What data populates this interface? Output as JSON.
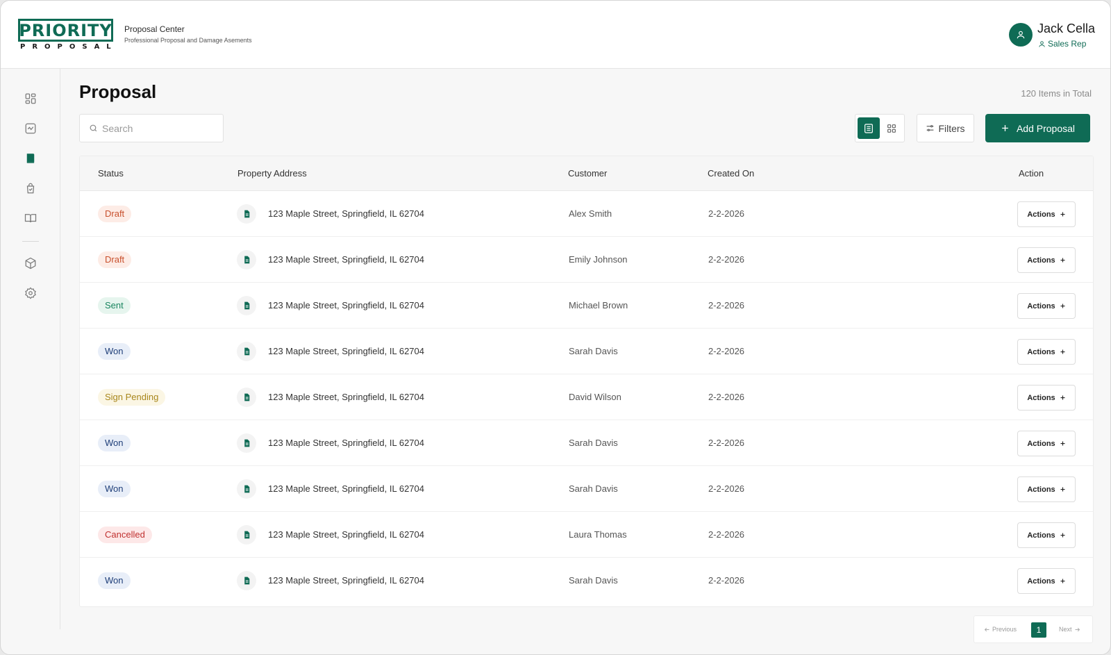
{
  "brand": {
    "logo_top": "PRIORITY",
    "logo_bottom": "PROPOSAL",
    "app_title": "Proposal Center",
    "app_subtitle": "Professional Proposal and Damage Asements",
    "accent": "#0f6b55"
  },
  "user": {
    "name": "Jack Cella",
    "role": "Sales Rep"
  },
  "sidebar": {
    "items": [
      {
        "icon": "dashboard-icon",
        "active": false
      },
      {
        "icon": "activity-icon",
        "active": false
      },
      {
        "icon": "book-icon",
        "active": true
      },
      {
        "icon": "bag-check-icon",
        "active": false
      },
      {
        "icon": "open-book-icon",
        "active": false
      },
      {
        "icon": "box-icon",
        "active": false
      },
      {
        "icon": "settings-icon",
        "active": false
      }
    ]
  },
  "page": {
    "title": "Proposal",
    "total": "120 Items in Total",
    "search_placeholder": "Search",
    "filters_label": "Filters",
    "add_label": "Add Proposal"
  },
  "table": {
    "columns": [
      "Status",
      "Property Address",
      "Customer",
      "Created On",
      "Action"
    ],
    "rows": [
      {
        "status": "Draft",
        "address": "123 Maple Street, Springfield, IL 62704",
        "customer": "Alex Smith",
        "created": "2-2-2026",
        "action": "Actions"
      },
      {
        "status": "Draft",
        "address": "123 Maple Street, Springfield, IL 62704",
        "customer": "Emily Johnson",
        "created": "2-2-2026",
        "action": "Actions"
      },
      {
        "status": "Sent",
        "address": "123 Maple Street, Springfield, IL 62704",
        "customer": "Michael Brown",
        "created": "2-2-2026",
        "action": "Actions"
      },
      {
        "status": "Won",
        "address": "123 Maple Street, Springfield, IL 62704",
        "customer": "Sarah Davis",
        "created": "2-2-2026",
        "action": "Actions"
      },
      {
        "status": "Sign Pending",
        "address": "123 Maple Street, Springfield, IL 62704",
        "customer": "David Wilson",
        "created": "2-2-2026",
        "action": "Actions"
      },
      {
        "status": "Won",
        "address": "123 Maple Street, Springfield, IL 62704",
        "customer": "Sarah Davis",
        "created": "2-2-2026",
        "action": "Actions"
      },
      {
        "status": "Won",
        "address": "123 Maple Street, Springfield, IL 62704",
        "customer": "Sarah Davis",
        "created": "2-2-2026",
        "action": "Actions"
      },
      {
        "status": "Cancelled",
        "address": "123 Maple Street, Springfield, IL 62704",
        "customer": "Laura Thomas",
        "created": "2-2-2026",
        "action": "Actions"
      },
      {
        "status": "Won",
        "address": "123 Maple Street, Springfield, IL 62704",
        "customer": "Sarah Davis",
        "created": "2-2-2026",
        "action": "Actions"
      }
    ]
  },
  "pagination": {
    "prev": "Previous",
    "current": "1",
    "next": "Next"
  }
}
